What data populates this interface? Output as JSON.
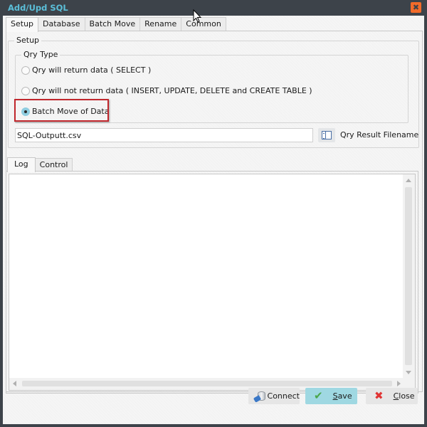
{
  "window": {
    "title": "Add/Upd SQL",
    "close_glyph": "✖"
  },
  "tabs": [
    {
      "label": "Setup",
      "active": true
    },
    {
      "label": "Database",
      "active": false
    },
    {
      "label": "Batch Move",
      "active": false
    },
    {
      "label": "Rename",
      "active": false
    },
    {
      "label": "Common",
      "active": false
    }
  ],
  "setup": {
    "group_label": "Setup",
    "qry_type": {
      "label": "Qry Type",
      "options": [
        {
          "label": "Qry will return data ( SELECT )",
          "checked": false
        },
        {
          "label": "Qry will not return data ( INSERT, UPDATE, DELETE and CREATE TABLE )",
          "checked": false
        },
        {
          "label": "Batch Move of Data",
          "checked": true
        }
      ]
    },
    "filename": {
      "value": "SQL-Outputt.csv",
      "label": "Qry Result Filename",
      "browse_icon": "browse-file-icon"
    }
  },
  "log_tabs": [
    {
      "label": "Log",
      "active": true
    },
    {
      "label": "Control",
      "active": false
    }
  ],
  "log": {
    "content": ""
  },
  "buttons": {
    "connect": {
      "label": "Connect",
      "icon": "database-plug-icon"
    },
    "save": {
      "label_u": "S",
      "label_rest": "ave",
      "icon": "checkmark-icon"
    },
    "close": {
      "label_u": "C",
      "label_rest": "lose",
      "icon": "red-x-icon"
    }
  },
  "colors": {
    "title_text": "#5bbfd9",
    "titlebar_bg": "#3d434a",
    "close_button": "#f26b2a",
    "save_button_bg": "#9fd8e2",
    "highlight_annotation": "#c1272d"
  }
}
